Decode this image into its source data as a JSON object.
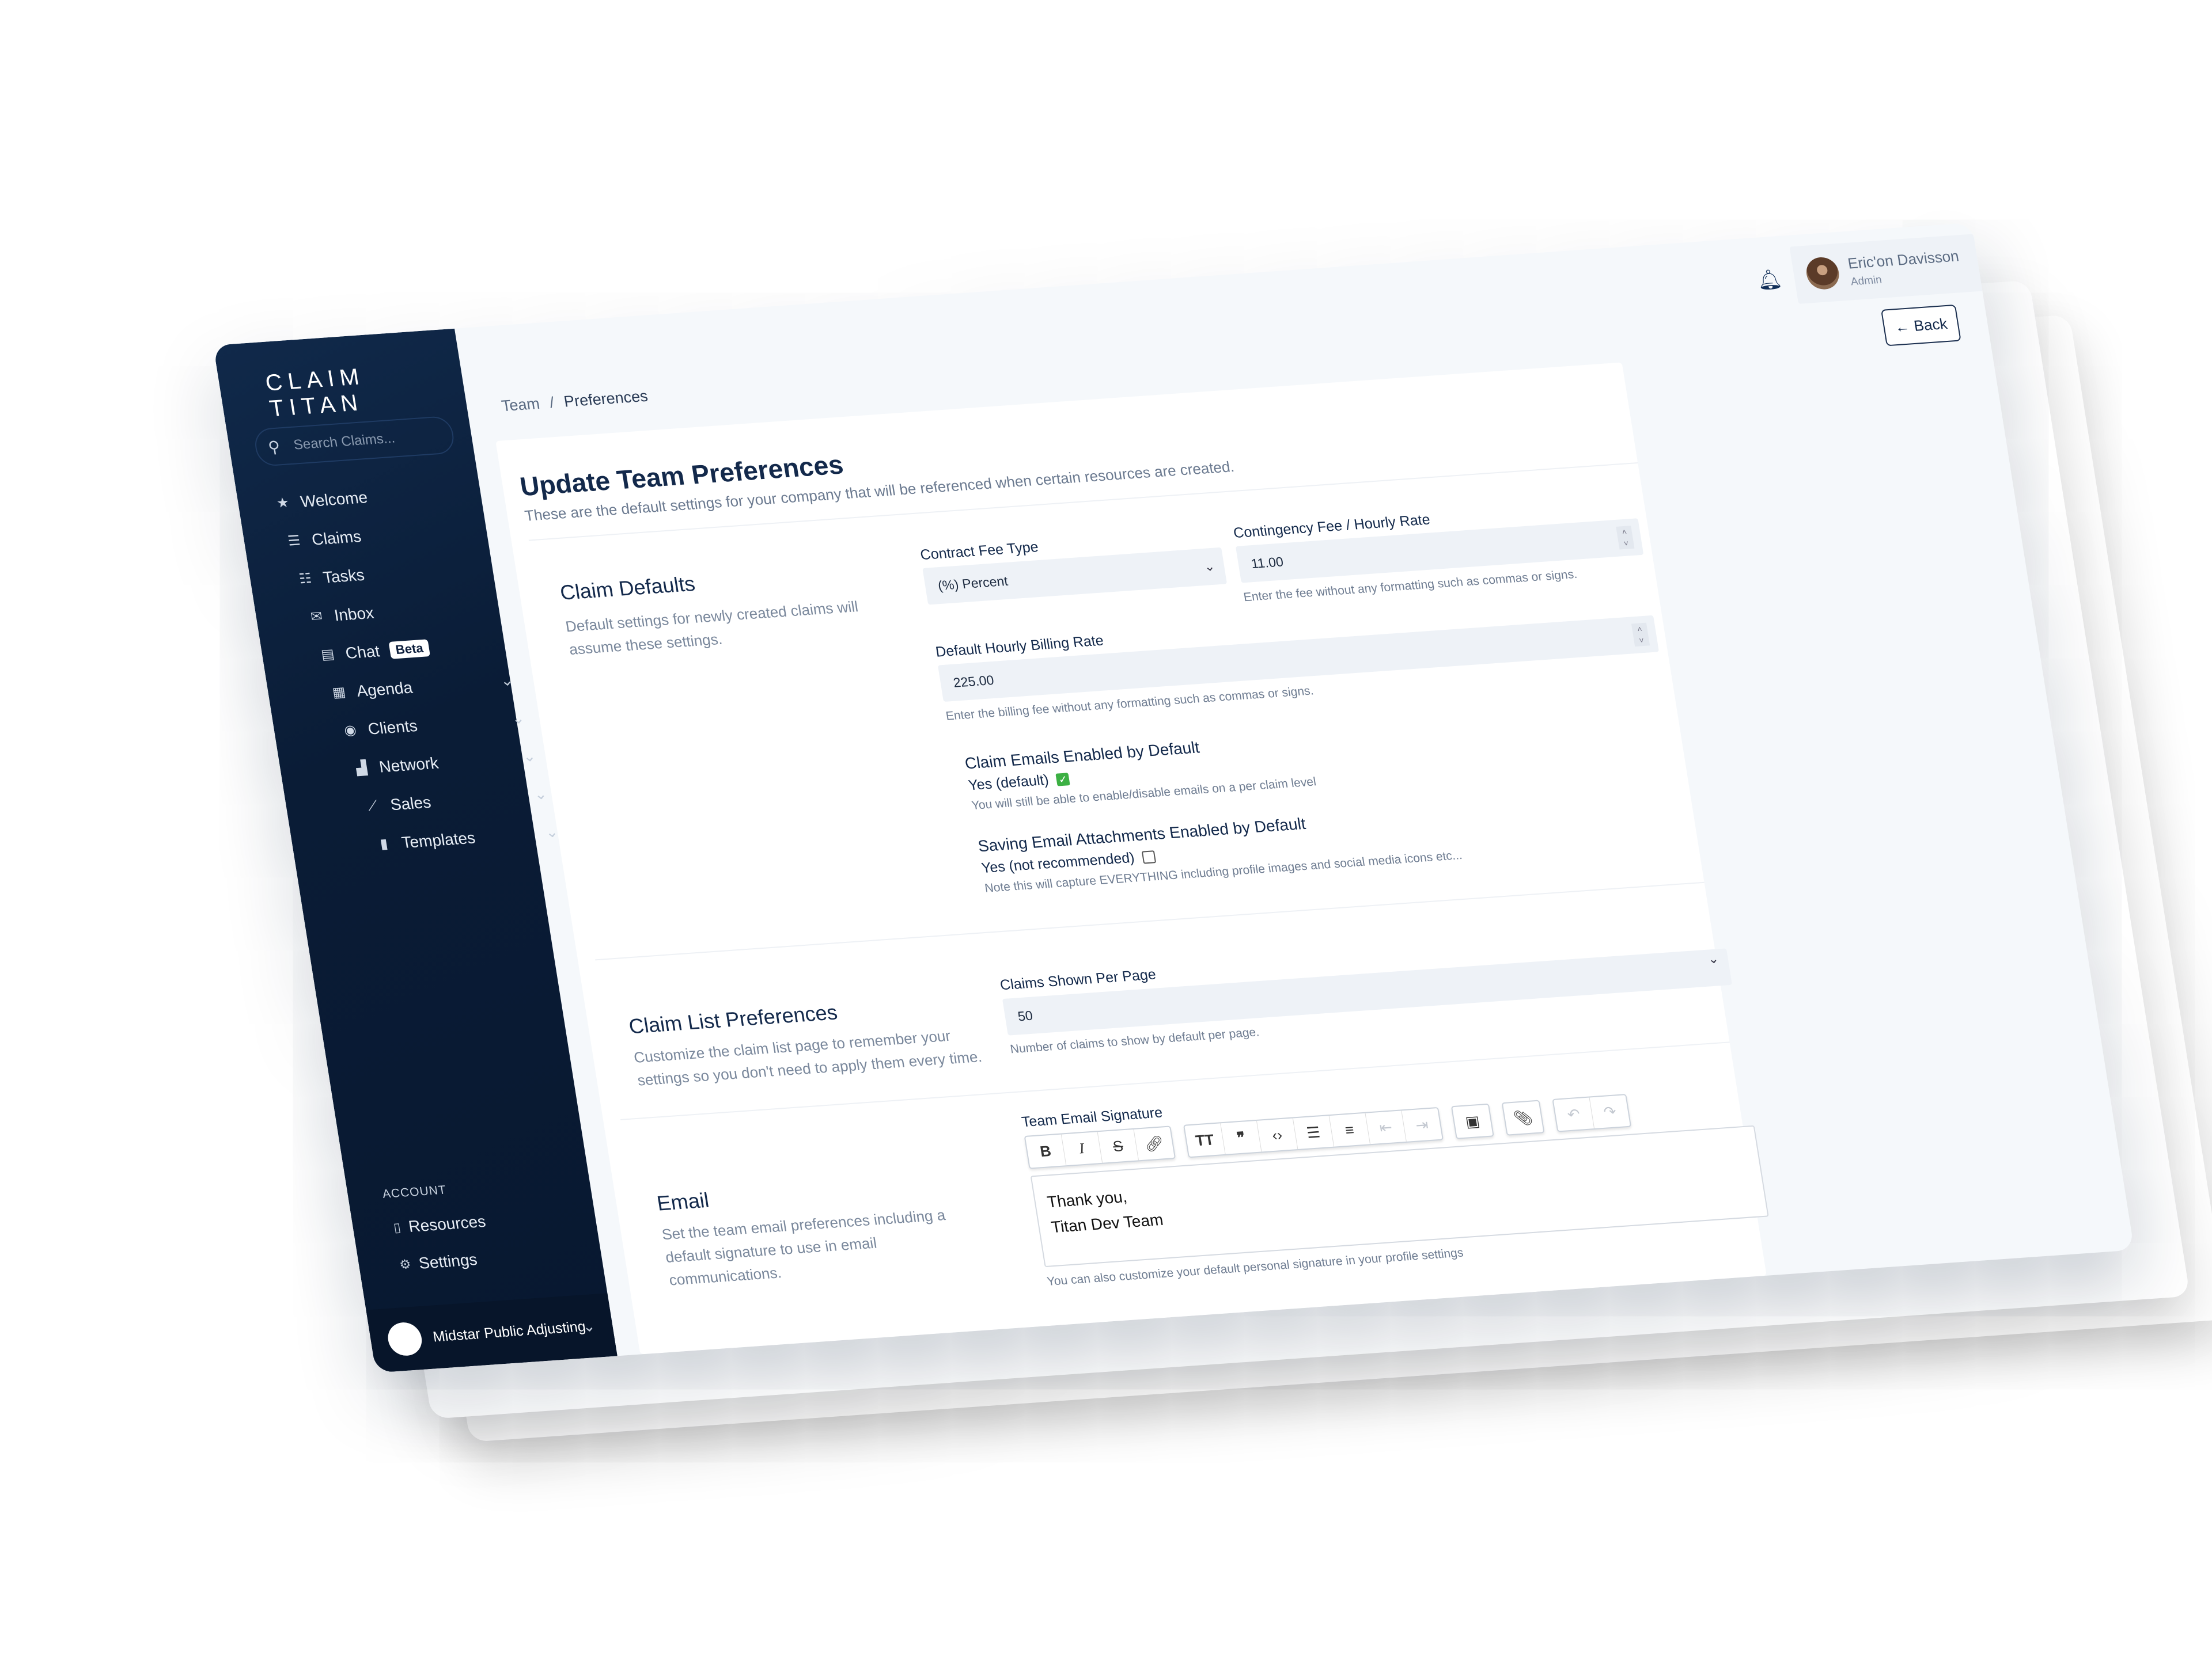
{
  "sidebar": {
    "logo": "CLAIM TITAN",
    "search_placeholder": "Search Claims...",
    "items": [
      {
        "label": "Welcome",
        "icon": "star-icon",
        "glyph": "★"
      },
      {
        "label": "Claims",
        "icon": "inbox-stack-icon",
        "glyph": "☰"
      },
      {
        "label": "Tasks",
        "icon": "tasks-icon",
        "glyph": "☷"
      },
      {
        "label": "Inbox",
        "icon": "mailbox-icon",
        "glyph": "✉"
      },
      {
        "label": "Chat",
        "icon": "chat-icon",
        "glyph": "▤",
        "badge": "Beta"
      },
      {
        "label": "Agenda",
        "icon": "calendar-icon",
        "glyph": "▦",
        "expandable": true
      },
      {
        "label": "Clients",
        "icon": "user-circle-icon",
        "glyph": "◉",
        "expandable": true
      },
      {
        "label": "Network",
        "icon": "buildings-icon",
        "glyph": "▟",
        "expandable": true
      },
      {
        "label": "Sales",
        "icon": "chart-line-icon",
        "glyph": "⟋",
        "expandable": true
      },
      {
        "label": "Templates",
        "icon": "document-icon",
        "glyph": "▮",
        "expandable": true
      }
    ],
    "account_label": "ACCOUNT",
    "account_items": [
      {
        "label": "Resources",
        "icon": "file-icon",
        "glyph": "▯"
      },
      {
        "label": "Settings",
        "icon": "gear-icon",
        "glyph": "⚙"
      }
    ],
    "organization": "Midstar Public Adjusting"
  },
  "header": {
    "user_name": "Eric'on Davisson",
    "user_role": "Admin",
    "back_label": "← Back"
  },
  "breadcrumb": {
    "parent": "Team",
    "separator": "/",
    "current": "Preferences"
  },
  "page": {
    "title": "Update Team Preferences",
    "subtitle": "These are the default settings for your company that will be referenced when certain resources are created."
  },
  "claim_defaults": {
    "title": "Claim Defaults",
    "description": "Default settings for newly created claims will assume these settings.",
    "contract_fee_type": {
      "label": "Contract Fee Type",
      "value": "(%) Percent"
    },
    "contingency_fee": {
      "label": "Contingency Fee / Hourly Rate",
      "value": "11.00",
      "help": "Enter the fee without any formatting such as commas or signs."
    },
    "hourly_rate": {
      "label": "Default Hourly Billing Rate",
      "value": "225.00",
      "help": "Enter the billing fee without any formatting such as commas or signs."
    },
    "claim_emails": {
      "label": "Claim Emails Enabled by Default",
      "option": "Yes (default)",
      "checked": true,
      "help": "You will still be able to enable/disable emails on a per claim level"
    },
    "attachments": {
      "label": "Saving Email Attachments Enabled by Default",
      "option": "Yes (not recommended)",
      "checked": false,
      "help": "Note this will capture EVERYTHING including profile images and social media icons etc..."
    }
  },
  "claim_list": {
    "title": "Claim List Preferences",
    "description": "Customize the claim list page to remember your settings so you don't need to apply them every time.",
    "per_page": {
      "label": "Claims Shown Per Page",
      "value": "50",
      "help": "Number of claims to show by default per page."
    }
  },
  "email": {
    "title": "Email",
    "description": "Set the team email preferences including a default signature to use in email communications.",
    "signature_label": "Team Email Signature",
    "signature_lines": [
      "Thank you,",
      "Titan Dev Team"
    ],
    "help": "You can also customize your default personal signature in your profile settings"
  },
  "colors": {
    "sidebar": "#0a1c36",
    "accent": "#13294b",
    "check": "#3cb043"
  }
}
